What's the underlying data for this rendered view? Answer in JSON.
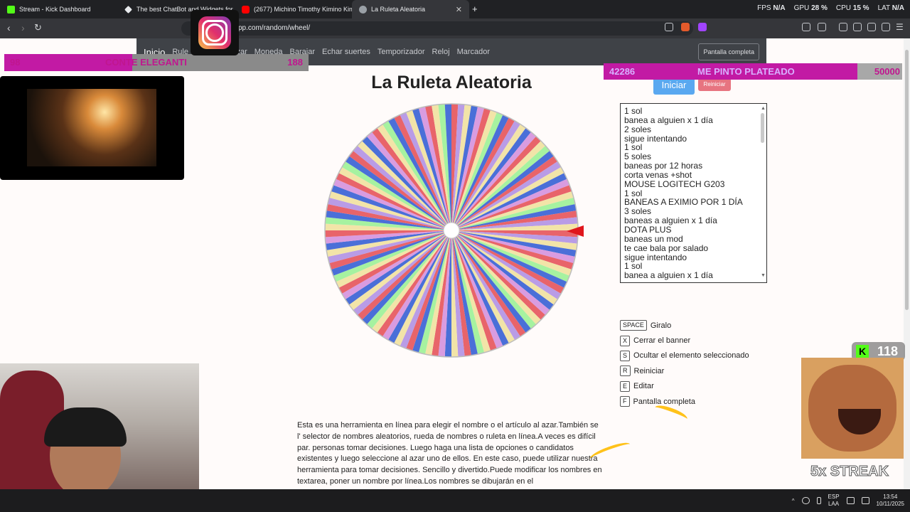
{
  "browser": {
    "tabs": [
      {
        "title": "Stream - Kick Dashboard",
        "icon": "kick-icon",
        "color": "#53fc18"
      },
      {
        "title": "The best ChatBot and Widgets for Ki",
        "icon": "diamond-icon",
        "color": "#e8eaed"
      },
      {
        "title": "(2677) Michino Timothy Kimino Kim",
        "icon": "youtube-icon",
        "color": "#ff0000"
      },
      {
        "title": "La Ruleta Aleatoria",
        "icon": "globe-icon",
        "color": "#9aa0a6",
        "active": true
      }
    ],
    "stats": [
      {
        "label": "FPS",
        "value": "N/A"
      },
      {
        "label": "GPU",
        "value": "28 %"
      },
      {
        "label": "CPU",
        "value": "15 %"
      },
      {
        "label": "LAT",
        "value": "N/A"
      }
    ],
    "url": "pp.com/random/wheel/"
  },
  "site": {
    "brand": "Inicio",
    "nav": [
      "Rule",
      "úmeros al azar",
      "Moneda",
      "Barajar",
      "Echar suertes",
      "Temporizador",
      "Reloj",
      "Marcador"
    ],
    "fullscreen": "Pantalla completa",
    "title": "La Ruleta Aleatoria",
    "start": "Iniciar",
    "reset": "Reiniciar",
    "options": [
      "1 sol",
      "banea a alguien x 1 día",
      "2 soles",
      "sigue intentando",
      "1 sol",
      "5 soles",
      "baneas por 12 horas",
      "corta venas +shot",
      "MOUSE LOGITECH G203",
      "1 sol",
      "BANEAS A EXIMIO POR 1 DÍA",
      "3 soles",
      "baneas a alguien x 1 día",
      "DOTA PLUS",
      "baneas un mod",
      "te cae bala por salado",
      "sigue intentando",
      "1 sol",
      "banea a alguien x 1 día"
    ],
    "shortcuts": [
      {
        "key": "SPACE",
        "label": "Giralo"
      },
      {
        "key": "X",
        "label": "Cerrar el banner"
      },
      {
        "key": "S",
        "label": "Ocultar el elemento seleccionado"
      },
      {
        "key": "R",
        "label": "Reiniciar"
      },
      {
        "key": "E",
        "label": "Editar"
      },
      {
        "key": "F",
        "label": "Pantalla completa"
      }
    ],
    "description": "Esta es una herramienta en línea para elegir el nombre o el artículo al azar.También se l' selector de nombres aleatorios, rueda de nombres o ruleta en línea.A veces es difícil par. personas tomar decisiones. Luego haga una lista de opciones o candidatos existentes y luego seleccione al azar uno de ellos. En este caso, puede utilizar nuestra herramienta para tomar decisiones. Sencillo y divertido.Puede modificar los nombres en textarea, poner un nombre por línea.Los nombres se dibujarán en el círculo.Simplemente haga clic en la rueda",
    "wheel_colors": [
      "#e8646a",
      "#b99ce6",
      "#f2e4a8",
      "#a6f2a0",
      "#4a6fd8",
      "#d99ce0"
    ],
    "wheel_segments": 120
  },
  "overlays": {
    "goal1": {
      "left": "98",
      "text": "CONTE ELEGANTI",
      "right": "188",
      "progress": 0.42
    },
    "goal2": {
      "left": "42286",
      "text": "ME PINTO PLATEADO",
      "right": "50000",
      "progress": 0.85
    },
    "kick_count": "118",
    "streak": "5x STREAK"
  },
  "taskbar": {
    "lang1": "ESP",
    "lang2": "LAA",
    "time": "13:54",
    "date": "10/11/2025"
  }
}
